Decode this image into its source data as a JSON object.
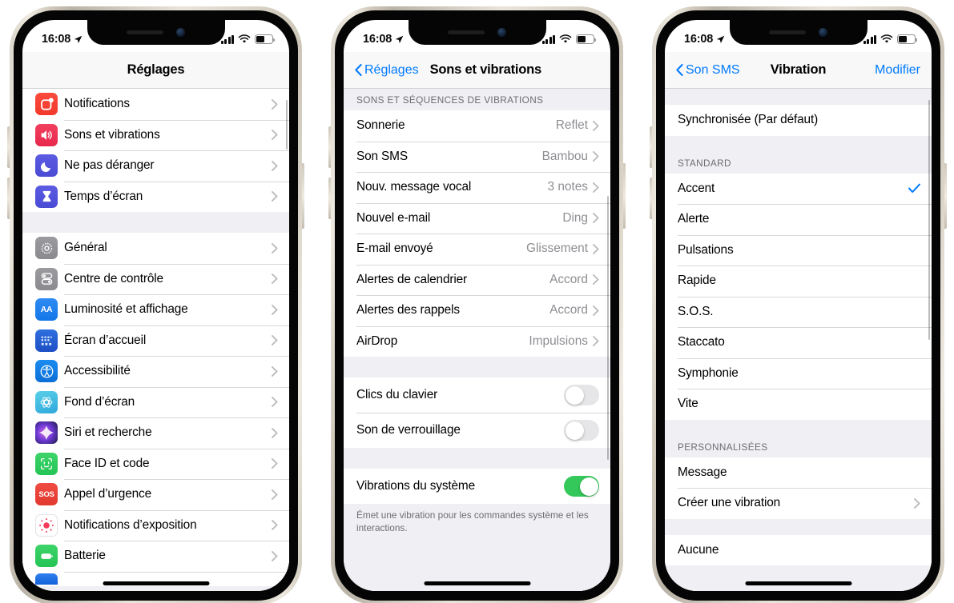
{
  "status_bar": {
    "time": "16:08",
    "location_icon": "location-arrow-icon",
    "signal_icon": "cellular-signal-icon",
    "wifi_icon": "wifi-icon",
    "battery_icon": "battery-icon"
  },
  "colors": {
    "accent_blue": "#007aff",
    "toggle_on_green": "#34c759",
    "list_bg": "#efeff4",
    "value_gray": "#8e8e93"
  },
  "phone1": {
    "nav": {
      "title": "Réglages"
    },
    "groups": [
      {
        "rows": [
          {
            "label": "Notifications",
            "icon": "notifications-icon",
            "chevron": true
          },
          {
            "label": "Sons et vibrations",
            "icon": "sounds-icon",
            "chevron": true
          },
          {
            "label": "Ne pas déranger",
            "icon": "do-not-disturb-icon",
            "chevron": true
          },
          {
            "label": "Temps d’écran",
            "icon": "screen-time-icon",
            "chevron": true
          }
        ]
      },
      {
        "rows": [
          {
            "label": "Général",
            "icon": "general-gear-icon",
            "chevron": true
          },
          {
            "label": "Centre de contrôle",
            "icon": "control-center-icon",
            "chevron": true
          },
          {
            "label": "Luminosité et affichage",
            "icon": "display-brightness-icon",
            "chevron": true
          },
          {
            "label": "Écran d’accueil",
            "icon": "home-screen-icon",
            "chevron": true
          },
          {
            "label": "Accessibilité",
            "icon": "accessibility-icon",
            "chevron": true
          },
          {
            "label": "Fond d’écran",
            "icon": "wallpaper-icon",
            "chevron": true
          },
          {
            "label": "Siri et recherche",
            "icon": "siri-icon",
            "chevron": true
          },
          {
            "label": "Face ID et code",
            "icon": "face-id-icon",
            "chevron": true
          },
          {
            "label": "Appel d’urgence",
            "icon": "sos-icon",
            "chevron": true
          },
          {
            "label": "Notifications d’exposition",
            "icon": "exposure-notifications-icon",
            "chevron": true
          },
          {
            "label": "Batterie",
            "icon": "battery-settings-icon",
            "chevron": true
          }
        ]
      }
    ]
  },
  "phone2": {
    "nav": {
      "back": "Réglages",
      "title": "Sons et vibrations"
    },
    "section_header": "SONS ET SÉQUENCES DE VIBRATIONS",
    "sound_rows": [
      {
        "label": "Sonnerie",
        "value": "Reflet"
      },
      {
        "label": "Son SMS",
        "value": "Bambou"
      },
      {
        "label": "Nouv. message vocal",
        "value": "3 notes"
      },
      {
        "label": "Nouvel e-mail",
        "value": "Ding"
      },
      {
        "label": "E-mail envoyé",
        "value": "Glissement"
      },
      {
        "label": "Alertes de calendrier",
        "value": "Accord"
      },
      {
        "label": "Alertes des rappels",
        "value": "Accord"
      },
      {
        "label": "AirDrop",
        "value": "Impulsions"
      }
    ],
    "toggle_rows": [
      {
        "label": "Clics du clavier",
        "on": false
      },
      {
        "label": "Son de verrouillage",
        "on": false
      }
    ],
    "system_row": {
      "label": "Vibrations du système",
      "on": true
    },
    "footer": "Émet une vibration pour les commandes système et les interactions."
  },
  "phone3": {
    "nav": {
      "back": "Son SMS",
      "title": "Vibration",
      "action": "Modifier"
    },
    "default_row": {
      "label": "Synchronisée (Par défaut)"
    },
    "standard_header": "STANDARD",
    "standard_rows": [
      {
        "label": "Accent",
        "selected": true
      },
      {
        "label": "Alerte",
        "selected": false
      },
      {
        "label": "Pulsations",
        "selected": false
      },
      {
        "label": "Rapide",
        "selected": false
      },
      {
        "label": "S.O.S.",
        "selected": false
      },
      {
        "label": "Staccato",
        "selected": false
      },
      {
        "label": "Symphonie",
        "selected": false
      },
      {
        "label": "Vite",
        "selected": false
      }
    ],
    "custom_header": "PERSONNALISÉES",
    "custom_rows": [
      {
        "label": "Message",
        "chevron": false
      },
      {
        "label": "Créer une vibration",
        "chevron": true
      }
    ],
    "none_row": {
      "label": "Aucune"
    }
  }
}
